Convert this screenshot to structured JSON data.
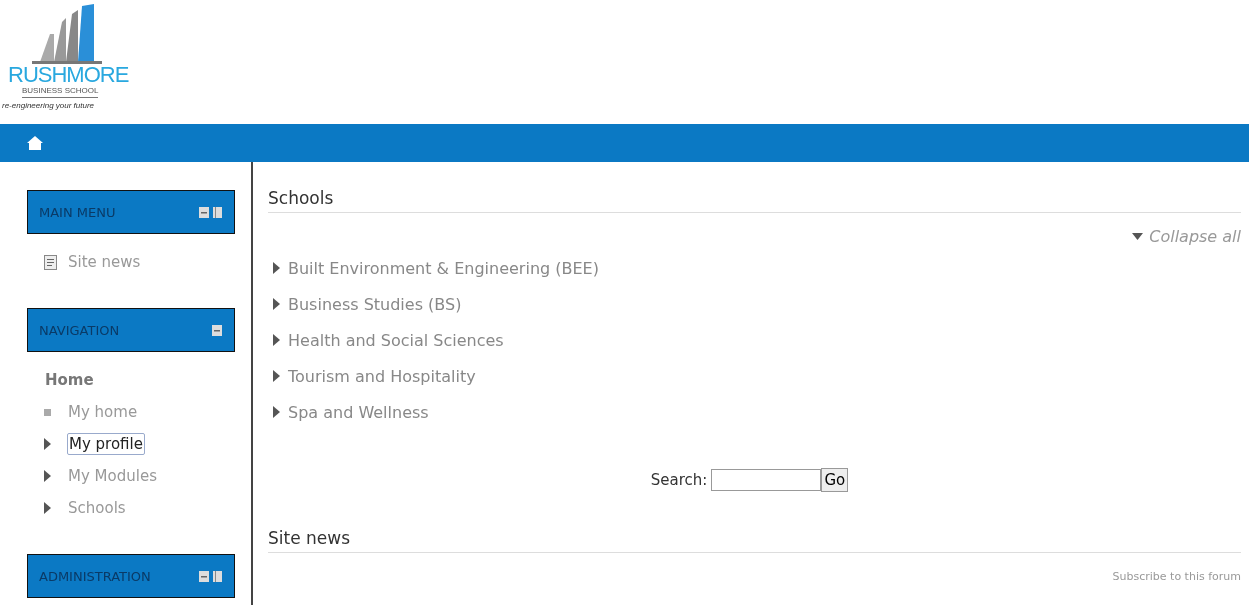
{
  "logo": {
    "name": "RUSHMORE",
    "subtitle": "BUSINESS SCHOOL",
    "tagline": "re-engineering your future"
  },
  "sidebar": {
    "blocks": [
      {
        "title": "MAIN MENU",
        "dockable": true,
        "items": [
          {
            "kind": "page",
            "label": "Site news",
            "selected": false
          }
        ]
      },
      {
        "title": "NAVIGATION",
        "dockable": false,
        "items": [
          {
            "kind": "header",
            "label": "Home",
            "selected": false
          },
          {
            "kind": "leaf",
            "label": "My home",
            "selected": false
          },
          {
            "kind": "branch",
            "label": "My profile",
            "selected": true
          },
          {
            "kind": "branch",
            "label": "My Modules",
            "selected": false
          },
          {
            "kind": "branch",
            "label": "Schools",
            "selected": false
          }
        ]
      },
      {
        "title": "ADMINISTRATION",
        "dockable": true
      }
    ]
  },
  "main": {
    "schools": {
      "heading": "Schools",
      "collapse_all": "Collapse all",
      "categories": [
        "Built Environment & Engineering (BEE)",
        "Business Studies (BS)",
        "Health and Social Sciences",
        "Tourism and Hospitality",
        "Spa and Wellness"
      ]
    },
    "search": {
      "label": "Search:",
      "button": "Go"
    },
    "site_news": {
      "heading": "Site news",
      "subscribe": "Subscribe to this forum"
    }
  }
}
